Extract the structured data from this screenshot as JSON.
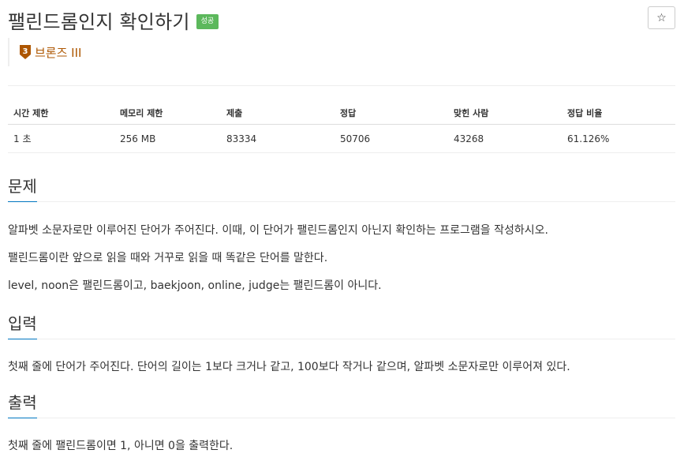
{
  "problem": {
    "title": "팰린드롬인지 확인하기",
    "result_badge": "성공",
    "tier": "브론즈 III",
    "tier_number": "3",
    "star_icon": "star-icon"
  },
  "info_table": {
    "headers": [
      "시간 제한",
      "메모리 제한",
      "제출",
      "정답",
      "맞힌 사람",
      "정답 비율"
    ],
    "row": [
      "1 초",
      "256 MB",
      "83334",
      "50706",
      "43268",
      "61.126%"
    ]
  },
  "sections": {
    "problem": {
      "heading": "문제",
      "paragraphs": [
        "알파벳 소문자로만 이루어진 단어가 주어진다. 이때, 이 단어가 팰린드롬인지 아닌지 확인하는 프로그램을 작성하시오.",
        "팰린드롬이란 앞으로 읽을 때와 거꾸로 읽을 때 똑같은 단어를 말한다.",
        "level, noon은 팰린드롬이고, baekjoon, online, judge는 팰린드롬이 아니다."
      ]
    },
    "input": {
      "heading": "입력",
      "paragraphs": [
        "첫째 줄에 단어가 주어진다. 단어의 길이는 1보다 크거나 같고, 100보다 작거나 같으며, 알파벳 소문자로만 이루어져 있다."
      ]
    },
    "output": {
      "heading": "출력",
      "paragraphs": [
        "첫째 줄에 팰린드롬이면 1, 아니면 0을 출력한다."
      ]
    }
  },
  "colors": {
    "badge": "#5cb85c",
    "tier": "#ad5600",
    "heading_underline": "#0076c0"
  }
}
